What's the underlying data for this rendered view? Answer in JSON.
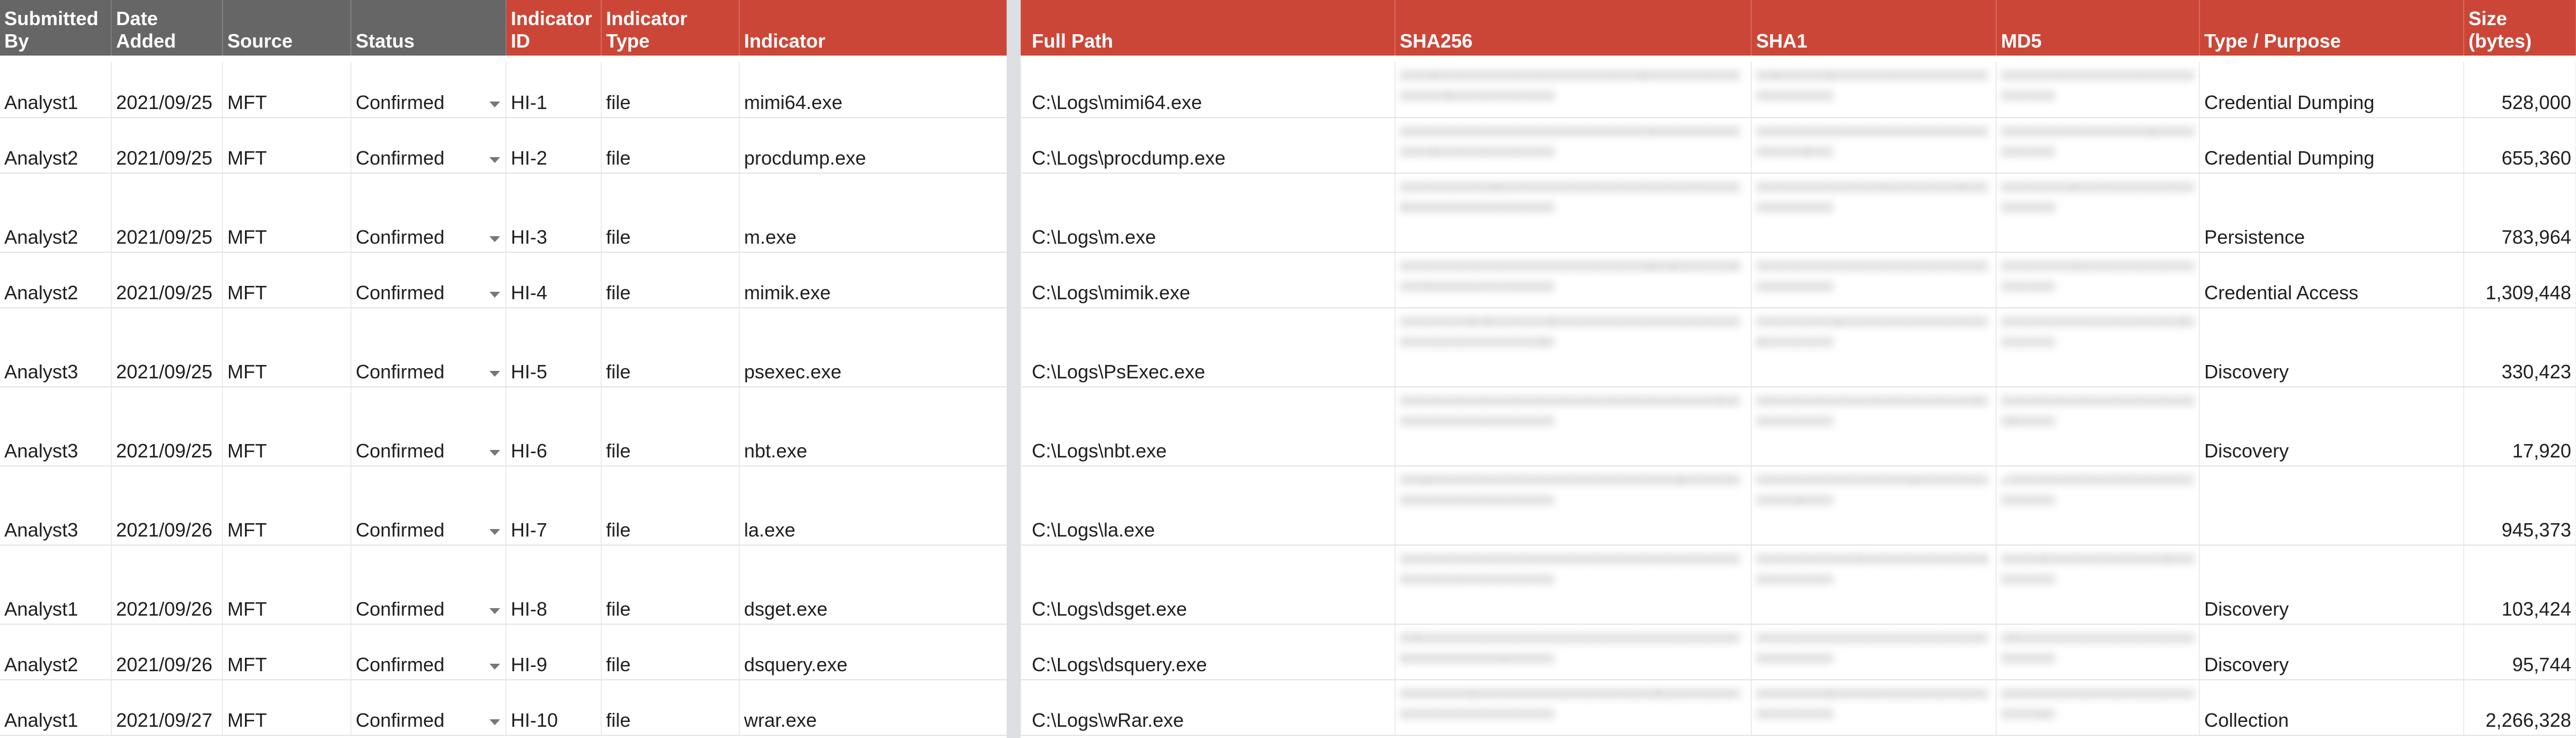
{
  "headers": {
    "submitted_by": "Submitted By",
    "date_added": "Date Added",
    "source": "Source",
    "status": "Status",
    "indicator_id": "Indicator ID",
    "indicator_type": "Indicator Type",
    "indicator": "Indicator",
    "full_path": "Full Path",
    "sha256": "SHA256",
    "sha1": "SHA1",
    "md5": "MD5",
    "type_purpose": "Type / Purpose",
    "size": "Size (bytes)"
  },
  "rows": [
    {
      "submitted_by": "Analyst1",
      "date_added": "2021/09/25",
      "source": "MFT",
      "status": "Confirmed",
      "indicator_id": "HI-1",
      "indicator_type": "file",
      "indicator": "mimi64.exe",
      "full_path": "C:\\Logs\\mimi64.exe",
      "type_purpose": "Credential Dumping",
      "size": "528,000"
    },
    {
      "submitted_by": "Analyst2",
      "date_added": "2021/09/25",
      "source": "MFT",
      "status": "Confirmed",
      "indicator_id": "HI-2",
      "indicator_type": "file",
      "indicator": "procdump.exe",
      "full_path": "C:\\Logs\\procdump.exe",
      "type_purpose": "Credential Dumping",
      "size": "655,360"
    },
    {
      "submitted_by": "Analyst2",
      "date_added": "2021/09/25",
      "source": "MFT",
      "status": "Confirmed",
      "indicator_id": "HI-3",
      "indicator_type": "file",
      "indicator": "m.exe",
      "full_path": "C:\\Logs\\m.exe",
      "type_purpose": "Persistence",
      "size": "783,964"
    },
    {
      "submitted_by": "Analyst2",
      "date_added": "2021/09/25",
      "source": "MFT",
      "status": "Confirmed",
      "indicator_id": "HI-4",
      "indicator_type": "file",
      "indicator": "mimik.exe",
      "full_path": "C:\\Logs\\mimik.exe",
      "type_purpose": "Credential Access",
      "size": "1,309,448"
    },
    {
      "submitted_by": "Analyst3",
      "date_added": "2021/09/25",
      "source": "MFT",
      "status": "Confirmed",
      "indicator_id": "HI-5",
      "indicator_type": "file",
      "indicator": "psexec.exe",
      "full_path": "C:\\Logs\\PsExec.exe",
      "type_purpose": "Discovery",
      "size": "330,423"
    },
    {
      "submitted_by": "Analyst3",
      "date_added": "2021/09/25",
      "source": "MFT",
      "status": "Confirmed",
      "indicator_id": "HI-6",
      "indicator_type": "file",
      "indicator": "nbt.exe",
      "full_path": "C:\\Logs\\nbt.exe",
      "type_purpose": "Discovery",
      "size": "17,920"
    },
    {
      "submitted_by": "Analyst3",
      "date_added": "2021/09/26",
      "source": "MFT",
      "status": "Confirmed",
      "indicator_id": "HI-7",
      "indicator_type": "file",
      "indicator": "la.exe",
      "full_path": "C:\\Logs\\la.exe",
      "type_purpose": "",
      "size": "945,373"
    },
    {
      "submitted_by": "Analyst1",
      "date_added": "2021/09/26",
      "source": "MFT",
      "status": "Confirmed",
      "indicator_id": "HI-8",
      "indicator_type": "file",
      "indicator": "dsget.exe",
      "full_path": "C:\\Logs\\dsget.exe",
      "type_purpose": "Discovery",
      "size": "103,424"
    },
    {
      "submitted_by": "Analyst2",
      "date_added": "2021/09/26",
      "source": "MFT",
      "status": "Confirmed",
      "indicator_id": "HI-9",
      "indicator_type": "file",
      "indicator": "dsquery.exe",
      "full_path": "C:\\Logs\\dsquery.exe",
      "type_purpose": "Discovery",
      "size": "95,744"
    },
    {
      "submitted_by": "Analyst1",
      "date_added": "2021/09/27",
      "source": "MFT",
      "status": "Confirmed",
      "indicator_id": "HI-10",
      "indicator_type": "file",
      "indicator": "wrar.exe",
      "full_path": "C:\\Logs\\wRar.exe",
      "type_purpose": "Collection",
      "size": "2,266,328"
    }
  ],
  "colors": {
    "header_gray": "#666666",
    "header_red": "#cc4637",
    "blurred_text": "#a8a8a8"
  },
  "icons": {
    "status_dropdown": "caret-down-icon"
  }
}
